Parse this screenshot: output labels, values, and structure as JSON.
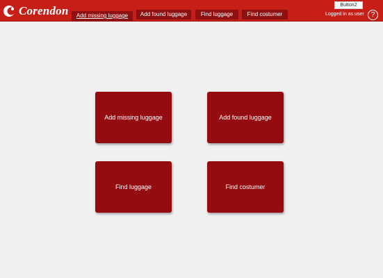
{
  "brand": {
    "name": "Corendon",
    "accent": "#c61f18",
    "tile_color": "#950c10"
  },
  "header": {
    "nav": [
      {
        "label": "Add missing luggage",
        "active": true
      },
      {
        "label": "Add found luggage",
        "active": false
      },
      {
        "label": "Find luggage",
        "active": false
      },
      {
        "label": "Find costumer",
        "active": false
      }
    ],
    "user_switch_label": "Button2",
    "logged_in_text": "Logged in as user",
    "help_label": "?"
  },
  "tiles": [
    {
      "label": "Add missing luggage"
    },
    {
      "label": "Add found luggage"
    },
    {
      "label": "Find luggage"
    },
    {
      "label": "Find costumer"
    }
  ]
}
